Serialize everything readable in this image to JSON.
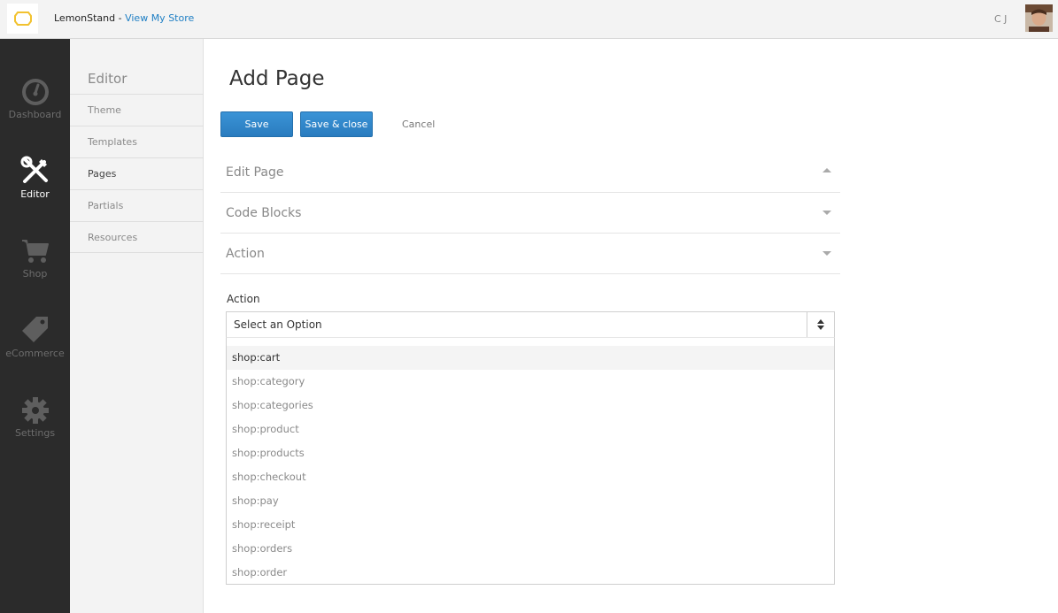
{
  "header": {
    "store_name": "LemonStand",
    "separator": " - ",
    "view_store_link": "View My Store",
    "user_initials": "C J"
  },
  "left_nav": [
    {
      "label": "Dashboard",
      "icon": "dashboard-gauge-icon"
    },
    {
      "label": "Editor",
      "icon": "editor-tools-icon",
      "active": true
    },
    {
      "label": "Shop",
      "icon": "shopping-cart-icon"
    },
    {
      "label": "eCommerce",
      "icon": "price-tag-icon"
    },
    {
      "label": "Settings",
      "icon": "gear-icon"
    }
  ],
  "sub_nav": {
    "title": "Editor",
    "items": [
      {
        "label": "Theme"
      },
      {
        "label": "Templates"
      },
      {
        "label": "Pages",
        "active": true
      },
      {
        "label": "Partials"
      },
      {
        "label": "Resources"
      }
    ]
  },
  "main": {
    "title": "Add Page",
    "save_label": "Save",
    "save_close_label": "Save & close",
    "cancel_label": "Cancel",
    "sections": [
      {
        "label": "Edit Page",
        "state": "expanded"
      },
      {
        "label": "Code Blocks",
        "state": "collapsed"
      },
      {
        "label": "Action",
        "state": "collapsed"
      }
    ],
    "action_field": {
      "label": "Action",
      "selected": "Select an Option",
      "options": [
        "shop:cart",
        "shop:category",
        "shop:categories",
        "shop:product",
        "shop:products",
        "shop:checkout",
        "shop:pay",
        "shop:receipt",
        "shop:orders",
        "shop:order"
      ],
      "highlighted_option": "shop:cart"
    }
  },
  "colors": {
    "accent": "#2a7cbf",
    "link": "#1f7fc4",
    "nav_bg": "#2b2b2b",
    "logo": "#f2c230"
  }
}
